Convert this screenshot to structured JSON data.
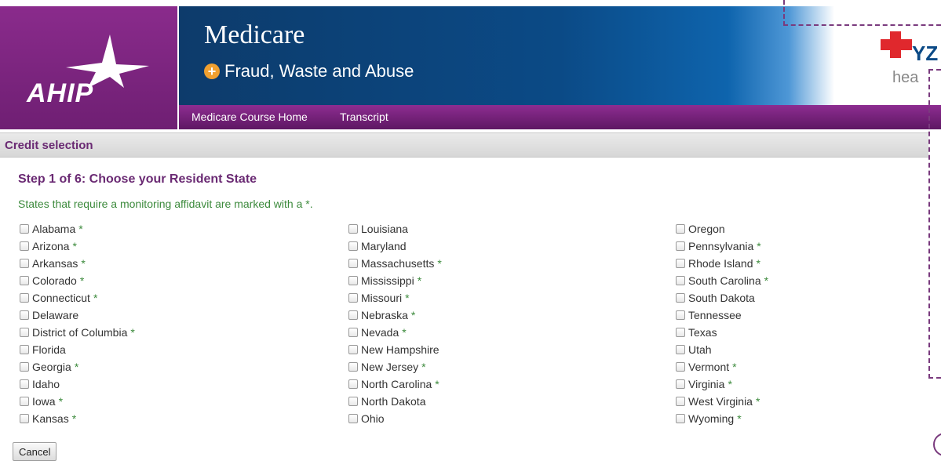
{
  "header": {
    "logo_text": "AHIP",
    "title": "Medicare",
    "subtitle": "Fraud, Waste and Abuse",
    "nav": [
      "Medicare Course Home",
      "Transcript"
    ],
    "brand_partial": "YZ",
    "brand_partial_sub": "hea",
    "frame_partial_text": "",
    "colors": {
      "purple": "#6f1f73",
      "blue": "#0b4a86",
      "accent_orange": "#f0a030",
      "green_note": "#3c8a3c"
    }
  },
  "section": {
    "title": "Credit selection"
  },
  "step": {
    "heading": "Step 1 of 6: Choose your Resident State",
    "note": "States that require a monitoring affidavit are marked with a *."
  },
  "states": {
    "col1": [
      {
        "name": "Alabama",
        "star": "*"
      },
      {
        "name": "Arizona",
        "star": "*"
      },
      {
        "name": "Arkansas",
        "star": "*"
      },
      {
        "name": "Colorado",
        "star": "*"
      },
      {
        "name": "Connecticut",
        "star": "*"
      },
      {
        "name": "Delaware",
        "star": ""
      },
      {
        "name": "District of Columbia",
        "star": "*"
      },
      {
        "name": "Florida",
        "star": ""
      },
      {
        "name": "Georgia",
        "star": "*"
      },
      {
        "name": "Idaho",
        "star": ""
      },
      {
        "name": "Iowa",
        "star": "*"
      },
      {
        "name": "Kansas",
        "star": "*"
      }
    ],
    "col2": [
      {
        "name": "Louisiana",
        "star": ""
      },
      {
        "name": "Maryland",
        "star": ""
      },
      {
        "name": "Massachusetts",
        "star": "*"
      },
      {
        "name": "Mississippi",
        "star": "*"
      },
      {
        "name": "Missouri",
        "star": "*"
      },
      {
        "name": "Nebraska",
        "star": "*"
      },
      {
        "name": "Nevada",
        "star": "*"
      },
      {
        "name": "New Hampshire",
        "star": ""
      },
      {
        "name": "New Jersey",
        "star": "*"
      },
      {
        "name": "North Carolina",
        "star": "*"
      },
      {
        "name": "North Dakota",
        "star": ""
      },
      {
        "name": "Ohio",
        "star": ""
      }
    ],
    "col3": [
      {
        "name": "Oregon",
        "star": ""
      },
      {
        "name": "Pennsylvania",
        "star": "*"
      },
      {
        "name": "Rhode Island",
        "star": "*"
      },
      {
        "name": "South Carolina",
        "star": "*"
      },
      {
        "name": "South Dakota",
        "star": ""
      },
      {
        "name": "Tennessee",
        "star": ""
      },
      {
        "name": "Texas",
        "star": ""
      },
      {
        "name": "Utah",
        "star": ""
      },
      {
        "name": "Vermont",
        "star": "*"
      },
      {
        "name": "Virginia",
        "star": "*"
      },
      {
        "name": "West Virginia",
        "star": "*"
      },
      {
        "name": "Wyoming",
        "star": "*"
      }
    ]
  },
  "actions": {
    "cancel_label": "Cancel"
  }
}
